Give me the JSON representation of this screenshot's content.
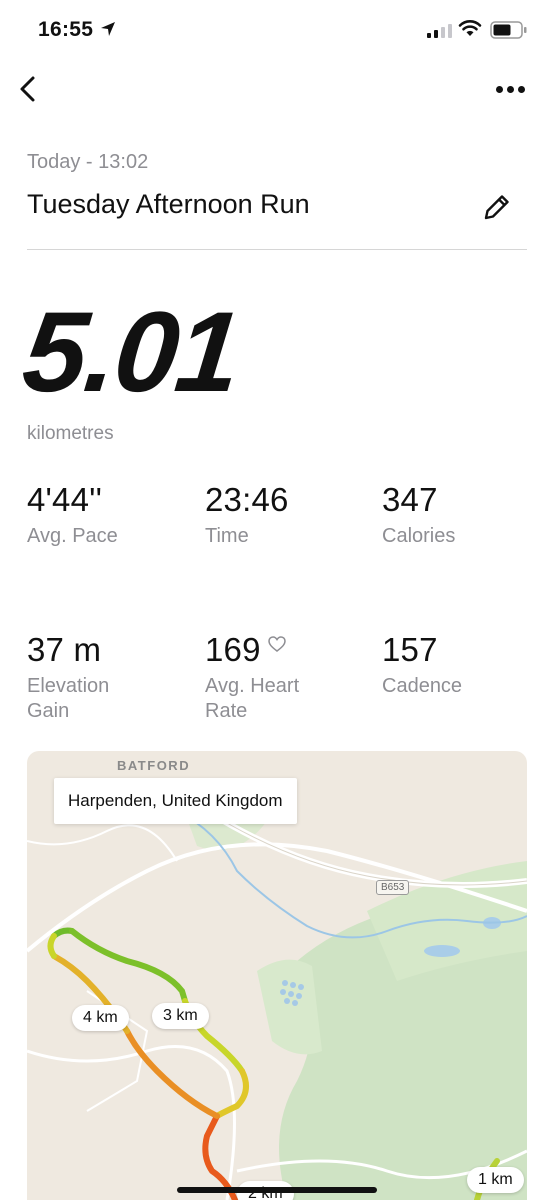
{
  "status_bar": {
    "time": "16:55"
  },
  "header": {
    "date": "Today - 13:02",
    "title": "Tuesday Afternoon Run"
  },
  "summary": {
    "distance": "5.01",
    "distance_unit": "kilometres"
  },
  "stats": [
    {
      "value": "4'44''",
      "label": "Avg. Pace"
    },
    {
      "value": "23:46",
      "label": "Time"
    },
    {
      "value": "347",
      "label": "Calories"
    },
    {
      "value": "37 m",
      "label": "Elevation Gain"
    },
    {
      "value": "169",
      "label": "Avg. Heart Rate"
    },
    {
      "value": "157",
      "label": "Cadence"
    }
  ],
  "map": {
    "location": "Harpenden, United Kingdom",
    "area_label": "BATFORD",
    "road_label": "B653",
    "km_markers": [
      "4 km",
      "3 km",
      "2 km",
      "1 km"
    ]
  },
  "icons": {
    "back": "back-chevron-icon",
    "more": "more-dots-icon",
    "edit": "pencil-icon",
    "heart": "heart-outline-icon",
    "location": "location-arrow-icon",
    "wifi": "wifi-icon",
    "battery": "battery-icon",
    "signal": "signal-icon"
  },
  "colors": {
    "route_start": "#7cc02a",
    "route_mid": "#e0d12a",
    "route_end": "#e8631f",
    "secondary_text": "#8e8e93"
  }
}
